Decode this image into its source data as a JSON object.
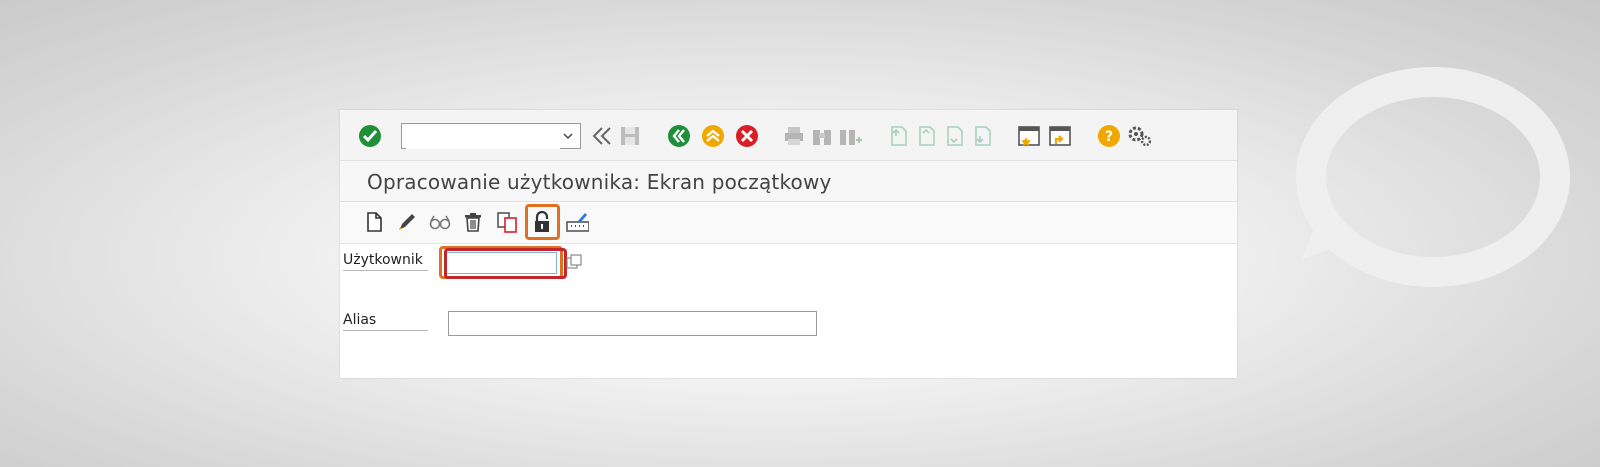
{
  "window": {
    "title": "Opracowanie użytkownika: Ekran początkowy"
  },
  "toolbar": {
    "command_field_value": "",
    "icons": [
      "enter-icon",
      "command-dropdown",
      "back-arrows-icon",
      "save-icon",
      "back-icon",
      "exit-icon",
      "cancel-icon",
      "print-icon",
      "find-icon",
      "find-next-icon",
      "first-page-icon",
      "previous-page-icon",
      "next-page-icon",
      "last-page-icon",
      "create-session-icon",
      "shortcut-icon",
      "help-icon",
      "settings-icon"
    ]
  },
  "app_toolbar": {
    "icons": [
      "create-icon",
      "change-icon",
      "display-icon",
      "delete-icon",
      "copy-icon",
      "lock-unlock-icon",
      "change-password-icon"
    ]
  },
  "form": {
    "user_label": "Użytkownik",
    "user_value": "",
    "alias_label": "Alias",
    "alias_value": ""
  },
  "colors": {
    "green": "#1f8f3a",
    "yellow": "#f0a800",
    "red": "#d61f26",
    "highlight_orange": "#e07020",
    "highlight_red": "#c0262a"
  }
}
